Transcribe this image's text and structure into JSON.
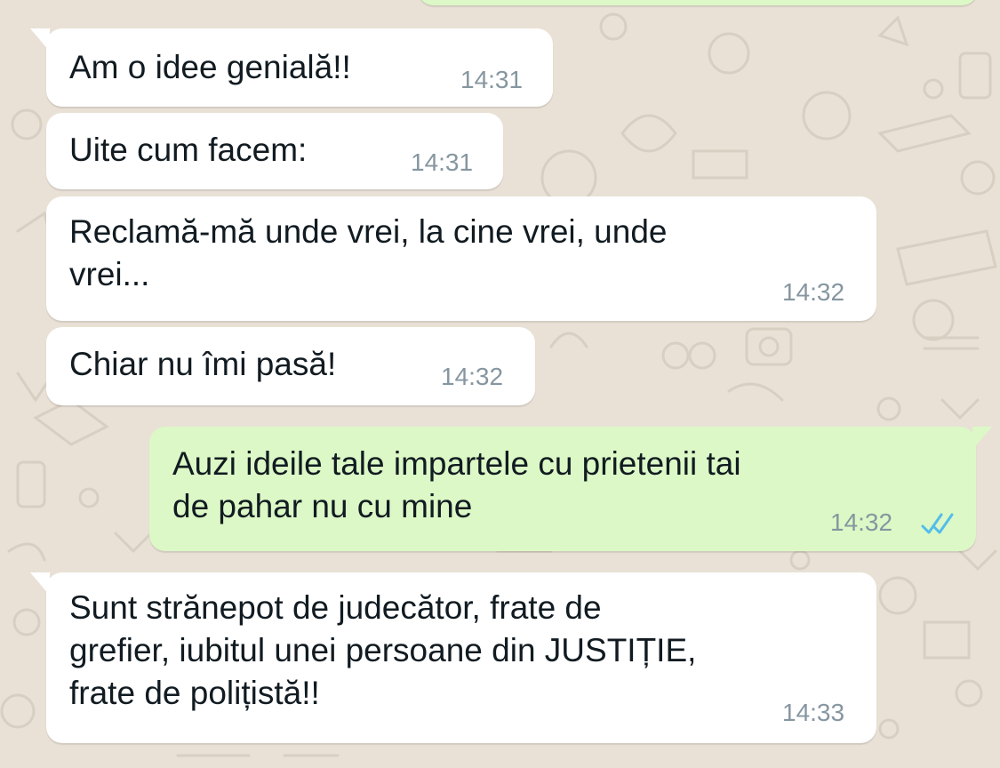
{
  "colors": {
    "background": "#E9E1D6",
    "incoming_bubble": "#FFFFFF",
    "outgoing_bubble": "#DCF8C6",
    "text": "#111B21",
    "timestamp": "#8696A0",
    "read_ticks": "#53BDEB"
  },
  "messages": [
    {
      "direction": "incoming",
      "text": "Am o idee genială!!",
      "time": "14:31"
    },
    {
      "direction": "incoming",
      "text": "Uite cum facem:",
      "time": "14:31"
    },
    {
      "direction": "incoming",
      "text": "Reclamă-mă unde vrei, la cine vrei, unde\nvrei...",
      "time": "14:32"
    },
    {
      "direction": "incoming",
      "text": "Chiar nu îmi pasă!",
      "time": "14:32"
    },
    {
      "direction": "outgoing",
      "text": "Auzi ideile tale impartele cu prietenii tai\nde pahar nu cu mine",
      "time": "14:32",
      "status": "read-double-check-icon"
    },
    {
      "direction": "incoming",
      "text": "Sunt strănepot de judecător, frate de\ngrefier, iubitul unei persoane din JUSTIȚIE,\nfrate de polițistă!!",
      "time": "14:33"
    }
  ]
}
